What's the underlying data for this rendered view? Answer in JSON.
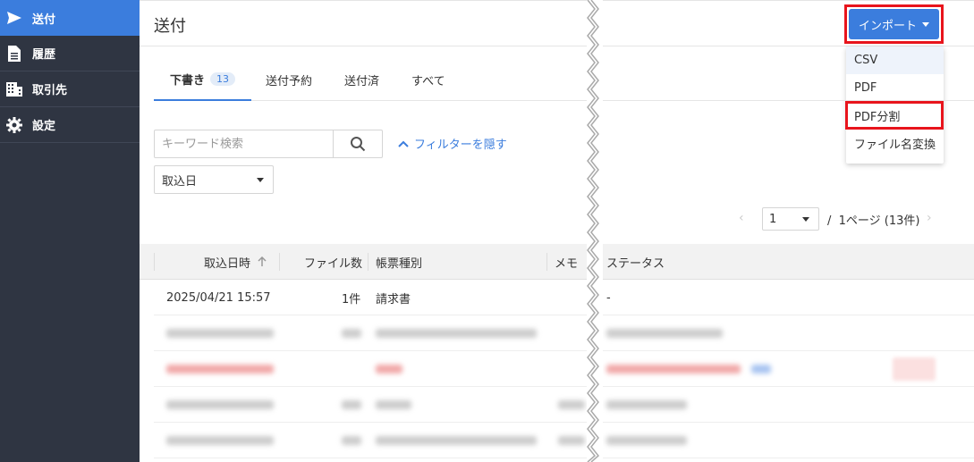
{
  "sidebar": {
    "items": [
      {
        "label": "送付",
        "icon": "send-icon",
        "active": true
      },
      {
        "label": "履歴",
        "icon": "document-icon",
        "active": false
      },
      {
        "label": "取引先",
        "icon": "building-icon",
        "active": false
      },
      {
        "label": "設定",
        "icon": "gear-icon",
        "active": false
      }
    ]
  },
  "header": {
    "title": "送付",
    "import_label": "インポート"
  },
  "import_menu": {
    "items": [
      "CSV",
      "PDF",
      "PDF分割",
      "ファイル名変換"
    ]
  },
  "tabs": [
    {
      "label": "下書き",
      "badge": "13"
    },
    {
      "label": "送付予約"
    },
    {
      "label": "送付済"
    },
    {
      "label": "すべて"
    }
  ],
  "filters": {
    "search_placeholder": "キーワード検索",
    "filter_toggle": "フィルターを隠す",
    "date_select": "取込日"
  },
  "pagination": {
    "page": "1",
    "separator": "/",
    "summary": "1ページ (13件)"
  },
  "table": {
    "headers": {
      "imported_at": "取込日時",
      "file_count": "ファイル数",
      "doc_type": "帳票種別",
      "memo": "メモ",
      "status": "ステータス"
    },
    "rows": [
      {
        "imported_at": "2025/04/21 15:57",
        "file_count": "1件",
        "doc_type": "請求書",
        "memo": "",
        "status": "-"
      }
    ]
  },
  "colors": {
    "sidebar_bg": "#2f3542",
    "accent": "#3b7ddd",
    "highlight_border": "#e8141c"
  }
}
